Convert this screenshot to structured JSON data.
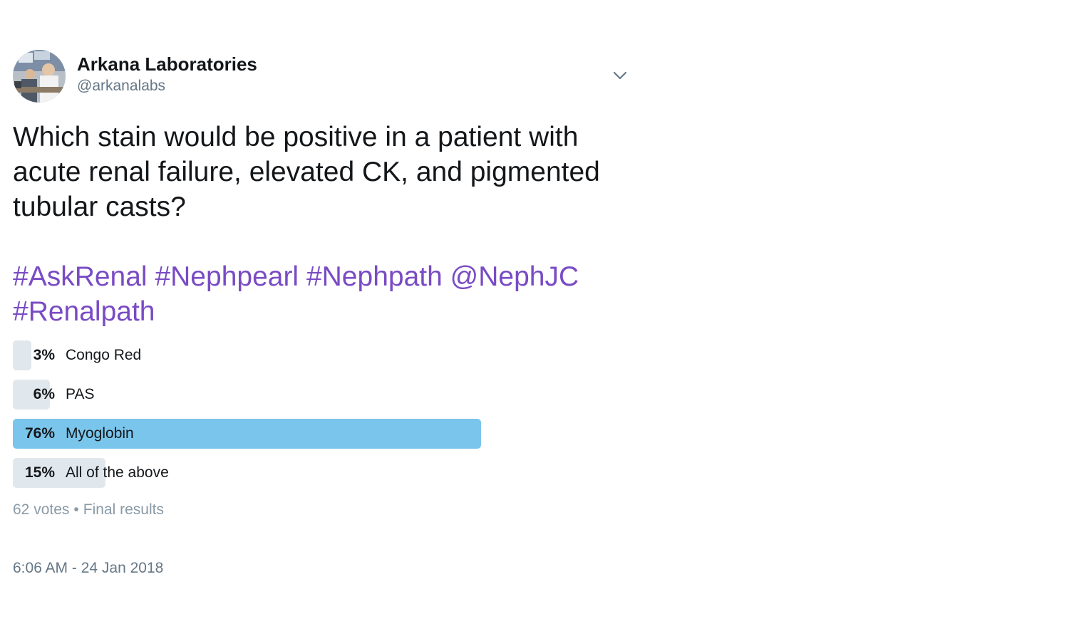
{
  "author": {
    "display_name": "Arkana Laboratories",
    "handle": "@arkanalabs"
  },
  "tweet": {
    "text": "Which stain would be positive in a patient with acute renal failure, elevated CK, and pigmented tubular casts?",
    "hashtags_line1": [
      "#AskRenal",
      "#Nephpearl",
      "#Nephpath",
      "@NephJC"
    ],
    "hashtags_line2": [
      "#Renalpath"
    ]
  },
  "poll": {
    "choices": [
      {
        "percent_label": "3%",
        "label": "Congo Red",
        "percent": 3,
        "winner": false
      },
      {
        "percent_label": "6%",
        "label": "PAS",
        "percent": 6,
        "winner": false
      },
      {
        "percent_label": "76%",
        "label": "Myoglobin",
        "percent": 76,
        "winner": true
      },
      {
        "percent_label": "15%",
        "label": "All of the above",
        "percent": 15,
        "winner": false
      }
    ],
    "votes": "62 votes",
    "separator": "•",
    "status": "Final results"
  },
  "timestamp": "6:06 AM - 24 Jan 2018",
  "icons": {
    "caret": "chevron-down-icon",
    "avatar": "avatar"
  },
  "colors": {
    "hashtag": "#794bc4",
    "winner_bar": "#7ac5ec",
    "bar": "#e1e8ed",
    "muted": "#657786"
  }
}
